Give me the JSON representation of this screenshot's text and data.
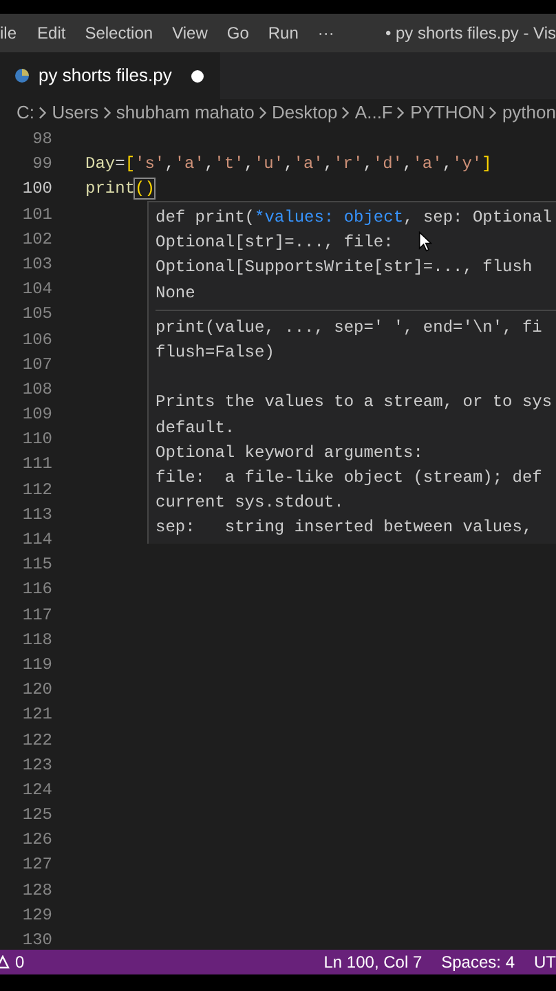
{
  "menu": [
    "ile",
    "Edit",
    "Selection",
    "View",
    "Go",
    "Run",
    "···"
  ],
  "window": {
    "title": "• py shorts files.py - Vis"
  },
  "tabs": [
    {
      "label": "py shorts files.py",
      "selected": true,
      "modified": true
    }
  ],
  "breadcrumb": [
    "C:",
    "Users",
    "shubham mahato",
    "Desktop",
    "A...F",
    "PYTHON",
    "python"
  ],
  "editor": {
    "lines": [
      {
        "number": "98",
        "current": false
      },
      {
        "number": "99",
        "current": false,
        "tokens": [
          {
            "kind": "ident",
            "text": "Day"
          },
          {
            "kind": "punct",
            "text": "="
          },
          {
            "kind": "bracket",
            "text": "["
          },
          {
            "kind": "string",
            "text": "'s'"
          },
          {
            "kind": "punct",
            "text": ","
          },
          {
            "kind": "string",
            "text": "'a'"
          },
          {
            "kind": "punct",
            "text": ","
          },
          {
            "kind": "string",
            "text": "'t'"
          },
          {
            "kind": "punct",
            "text": ","
          },
          {
            "kind": "string",
            "text": "'u'"
          },
          {
            "kind": "punct",
            "text": ","
          },
          {
            "kind": "string",
            "text": "'a'"
          },
          {
            "kind": "punct",
            "text": ","
          },
          {
            "kind": "string",
            "text": "'r'"
          },
          {
            "kind": "punct",
            "text": ","
          },
          {
            "kind": "string",
            "text": "'d'"
          },
          {
            "kind": "punct",
            "text": ","
          },
          {
            "kind": "string",
            "text": "'a'"
          },
          {
            "kind": "punct",
            "text": ","
          },
          {
            "kind": "string",
            "text": "'y'"
          },
          {
            "kind": "bracket",
            "text": "]"
          }
        ]
      },
      {
        "number": "100",
        "current": true,
        "tokens": [
          {
            "kind": "ident",
            "text": "print"
          },
          {
            "kind": "matched",
            "text": "()"
          }
        ]
      },
      {
        "number": "101",
        "current": false
      },
      {
        "number": "102",
        "current": false
      },
      {
        "number": "103",
        "current": false
      },
      {
        "number": "104",
        "current": false
      },
      {
        "number": "105",
        "current": false
      },
      {
        "number": "106",
        "current": false
      },
      {
        "number": "107",
        "current": false
      },
      {
        "number": "108",
        "current": false
      },
      {
        "number": "109",
        "current": false
      },
      {
        "number": "110",
        "current": false
      },
      {
        "number": "111",
        "current": false
      },
      {
        "number": "112",
        "current": false
      },
      {
        "number": "113",
        "current": false
      },
      {
        "number": "114",
        "current": false
      },
      {
        "number": "115",
        "current": false
      },
      {
        "number": "116",
        "current": false
      },
      {
        "number": "117",
        "current": false
      },
      {
        "number": "118",
        "current": false
      },
      {
        "number": "119",
        "current": false
      },
      {
        "number": "120",
        "current": false
      },
      {
        "number": "121",
        "current": false
      },
      {
        "number": "122",
        "current": false
      },
      {
        "number": "123",
        "current": false
      },
      {
        "number": "124",
        "current": false
      },
      {
        "number": "125",
        "current": false
      },
      {
        "number": "126",
        "current": false
      },
      {
        "number": "127",
        "current": false
      },
      {
        "number": "128",
        "current": false
      },
      {
        "number": "129",
        "current": false
      },
      {
        "number": "130",
        "current": false
      }
    ]
  },
  "signature_help": {
    "signature": [
      [
        {
          "kind": "plain",
          "text": "def print("
        },
        {
          "kind": "param",
          "text": "*values: object"
        },
        {
          "kind": "plain",
          "text": ", sep: Optional"
        }
      ],
      [
        {
          "kind": "plain",
          "text": "Optional[str]=..., file:"
        }
      ],
      [
        {
          "kind": "plain",
          "text": "Optional[SupportsWrite[str]=..., flush"
        }
      ],
      [
        {
          "kind": "plain",
          "text": "None"
        }
      ]
    ],
    "doc": [
      [
        "print(value, ..., sep=' ', end='\\n', fi",
        "flush=False)"
      ],
      [
        "Prints the values to a stream, or to sys",
        "default.",
        "Optional keyword arguments:",
        "file:  a file-like object (stream); def",
        "current sys.stdout.",
        "sep:   string inserted between values,"
      ]
    ]
  },
  "status_bar": {
    "left": [
      {
        "kind": "warnings",
        "text": "0"
      }
    ],
    "right": [
      "Ln 100, Col 7",
      "Spaces: 4",
      "UT"
    ]
  }
}
